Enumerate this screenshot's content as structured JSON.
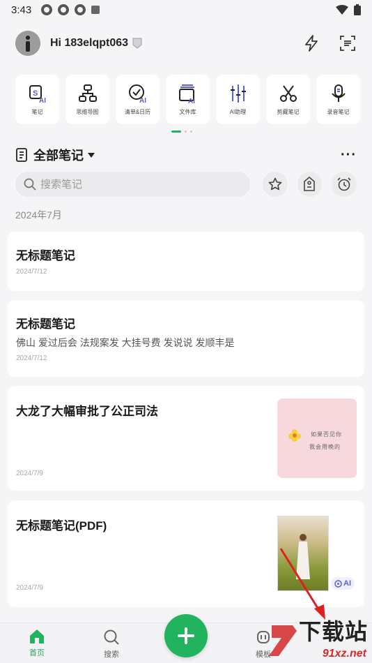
{
  "status_bar": {
    "time": "3:43"
  },
  "header": {
    "greeting": "Hi 183elqpt063"
  },
  "tools": [
    {
      "label": "笔记",
      "icon": "ai-note-icon"
    },
    {
      "label": "思维导图",
      "icon": "mindmap-icon"
    },
    {
      "label": "清单&日历",
      "icon": "checklist-calendar-icon"
    },
    {
      "label": "文件库",
      "icon": "file-library-icon"
    },
    {
      "label": "AI助理",
      "icon": "ai-assistant-icon"
    },
    {
      "label": "剪藏笔记",
      "icon": "scissors-icon"
    },
    {
      "label": "录音笔记",
      "icon": "microphone-icon"
    }
  ],
  "notes": {
    "title": "全部笔记",
    "search_placeholder": "搜索笔记",
    "month": "2024年7月",
    "items": [
      {
        "title": "无标题笔记",
        "body": "",
        "date": "2024/7/12"
      },
      {
        "title": "无标题笔记",
        "body": "佛山 爱过后会 法规案发 大挂号费 发说说 发顺丰是",
        "date": "2024/7/12"
      },
      {
        "title": "大龙了大幅审批了公正司法",
        "body": "",
        "date": "2024/7/9",
        "thumb_text": [
          "如果否见你",
          "我会用晚的"
        ]
      },
      {
        "title": "无标题笔记(PDF)",
        "body": "",
        "date": "2024/7/9",
        "ai_badge": "AI"
      }
    ]
  },
  "bottom_nav": [
    {
      "label": "首页",
      "active": true
    },
    {
      "label": "搜索",
      "active": false
    },
    {
      "label": "模板",
      "active": false
    }
  ],
  "watermark": {
    "title": "下载站",
    "url": "91xz.net"
  },
  "colors": {
    "accent": "#22b35e",
    "ai": "#5c5fd0"
  }
}
